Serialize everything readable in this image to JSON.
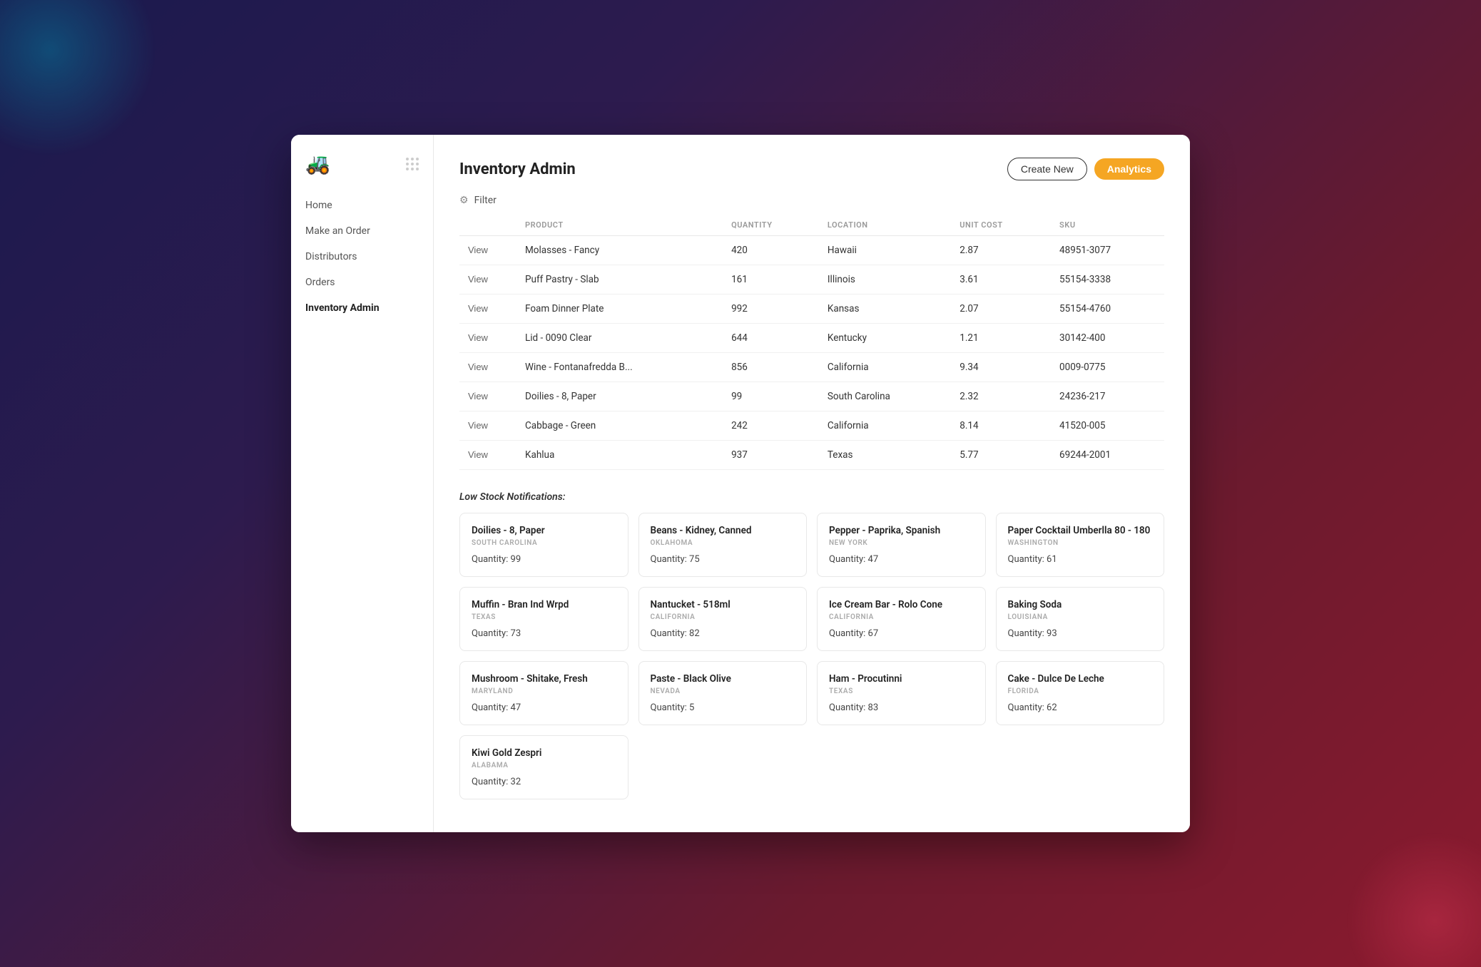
{
  "sidebar": {
    "logo": "🚜",
    "nav_items": [
      {
        "label": "Home",
        "active": false,
        "id": "home"
      },
      {
        "label": "Make an Order",
        "active": false,
        "id": "make-an-order"
      },
      {
        "label": "Distributors",
        "active": false,
        "id": "distributors"
      },
      {
        "label": "Orders",
        "active": false,
        "id": "orders"
      },
      {
        "label": "Inventory Admin",
        "active": true,
        "id": "inventory-admin"
      }
    ]
  },
  "header": {
    "title": "Inventory Admin",
    "create_label": "Create New",
    "analytics_label": "Analytics"
  },
  "filter": {
    "label": "Filter"
  },
  "table": {
    "columns": [
      "",
      "PRODUCT",
      "QUANTITY",
      "LOCATION",
      "UNIT COST",
      "SKU"
    ],
    "rows": [
      {
        "view": "View",
        "product": "Molasses - Fancy",
        "quantity": "420",
        "location": "Hawaii",
        "unit_cost": "2.87",
        "sku": "48951-3077"
      },
      {
        "view": "View",
        "product": "Puff Pastry - Slab",
        "quantity": "161",
        "location": "Illinois",
        "unit_cost": "3.61",
        "sku": "55154-3338"
      },
      {
        "view": "View",
        "product": "Foam Dinner Plate",
        "quantity": "992",
        "location": "Kansas",
        "unit_cost": "2.07",
        "sku": "55154-4760"
      },
      {
        "view": "View",
        "product": "Lid - 0090 Clear",
        "quantity": "644",
        "location": "Kentucky",
        "unit_cost": "1.21",
        "sku": "30142-400"
      },
      {
        "view": "View",
        "product": "Wine - Fontanafredda B...",
        "quantity": "856",
        "location": "California",
        "unit_cost": "9.34",
        "sku": "0009-0775"
      },
      {
        "view": "View",
        "product": "Doilies - 8, Paper",
        "quantity": "99",
        "location": "South Carolina",
        "unit_cost": "2.32",
        "sku": "24236-217"
      },
      {
        "view": "View",
        "product": "Cabbage - Green",
        "quantity": "242",
        "location": "California",
        "unit_cost": "8.14",
        "sku": "41520-005"
      },
      {
        "view": "View",
        "product": "Kahlua",
        "quantity": "937",
        "location": "Texas",
        "unit_cost": "5.77",
        "sku": "69244-2001"
      }
    ]
  },
  "low_stock": {
    "title": "Low Stock Notifications:",
    "cards": [
      {
        "name": "Doilies - 8, Paper",
        "location": "SOUTH CAROLINA",
        "quantity": "Quantity: 99"
      },
      {
        "name": "Beans - Kidney, Canned",
        "location": "OKLAHOMA",
        "quantity": "Quantity: 75"
      },
      {
        "name": "Pepper - Paprika, Spanish",
        "location": "NEW YORK",
        "quantity": "Quantity: 47"
      },
      {
        "name": "Paper Cocktail Umberlla 80 - 180",
        "location": "WASHINGTON",
        "quantity": "Quantity: 61"
      },
      {
        "name": "Muffin - Bran Ind Wrpd",
        "location": "TEXAS",
        "quantity": "Quantity: 73"
      },
      {
        "name": "Nantucket - 518ml",
        "location": "CALIFORNIA",
        "quantity": "Quantity: 82"
      },
      {
        "name": "Ice Cream Bar - Rolo Cone",
        "location": "CALIFORNIA",
        "quantity": "Quantity: 67"
      },
      {
        "name": "Baking Soda",
        "location": "LOUISIANA",
        "quantity": "Quantity: 93"
      },
      {
        "name": "Mushroom - Shitake, Fresh",
        "location": "MARYLAND",
        "quantity": "Quantity: 47"
      },
      {
        "name": "Paste - Black Olive",
        "location": "NEVADA",
        "quantity": "Quantity: 5"
      },
      {
        "name": "Ham - Procutinni",
        "location": "TEXAS",
        "quantity": "Quantity: 83"
      },
      {
        "name": "Cake - Dulce De Leche",
        "location": "FLORIDA",
        "quantity": "Quantity: 62"
      },
      {
        "name": "Kiwi Gold Zespri",
        "location": "ALABAMA",
        "quantity": "Quantity: 32"
      }
    ]
  }
}
